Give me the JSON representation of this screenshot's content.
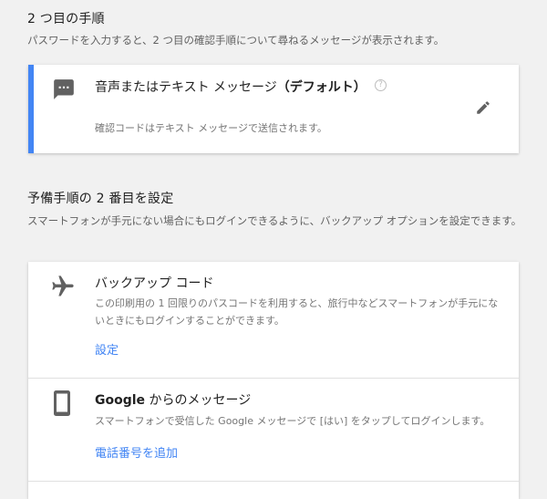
{
  "second_step": {
    "heading": "2 つ目の手順",
    "description": "パスワードを入力すると、2 つ目の確認手順について尋ねるメッセージが表示されます。",
    "method": {
      "title": "音声またはテキスト メッセージ",
      "default_tag": "（デフォルト）",
      "help": "?",
      "description": "確認コードはテキスト メッセージで送信されます。",
      "icon": "sms-icon",
      "edit_icon": "pencil-icon"
    },
    "accent_color": "#4285f4"
  },
  "backup_step": {
    "heading": "予備手順の 2 番目を設定",
    "description": "スマートフォンが手元にない場合にもログインできるように、バックアップ オプションを設定できます。",
    "options": [
      {
        "title": "バックアップ コード",
        "description": "この印刷用の 1 回限りのパスコードを利用すると、旅行中などスマートフォンが手元にないときにもログインすることができます。",
        "action": "設定",
        "icon": "airplane-icon"
      },
      {
        "title_brand": "Google",
        "title_rest": " からのメッセージ",
        "description": "スマートフォンで受信した Google メッセージで [はい] をタップしてログインします。",
        "action": "電話番号を追加",
        "icon": "phone-icon"
      }
    ]
  }
}
